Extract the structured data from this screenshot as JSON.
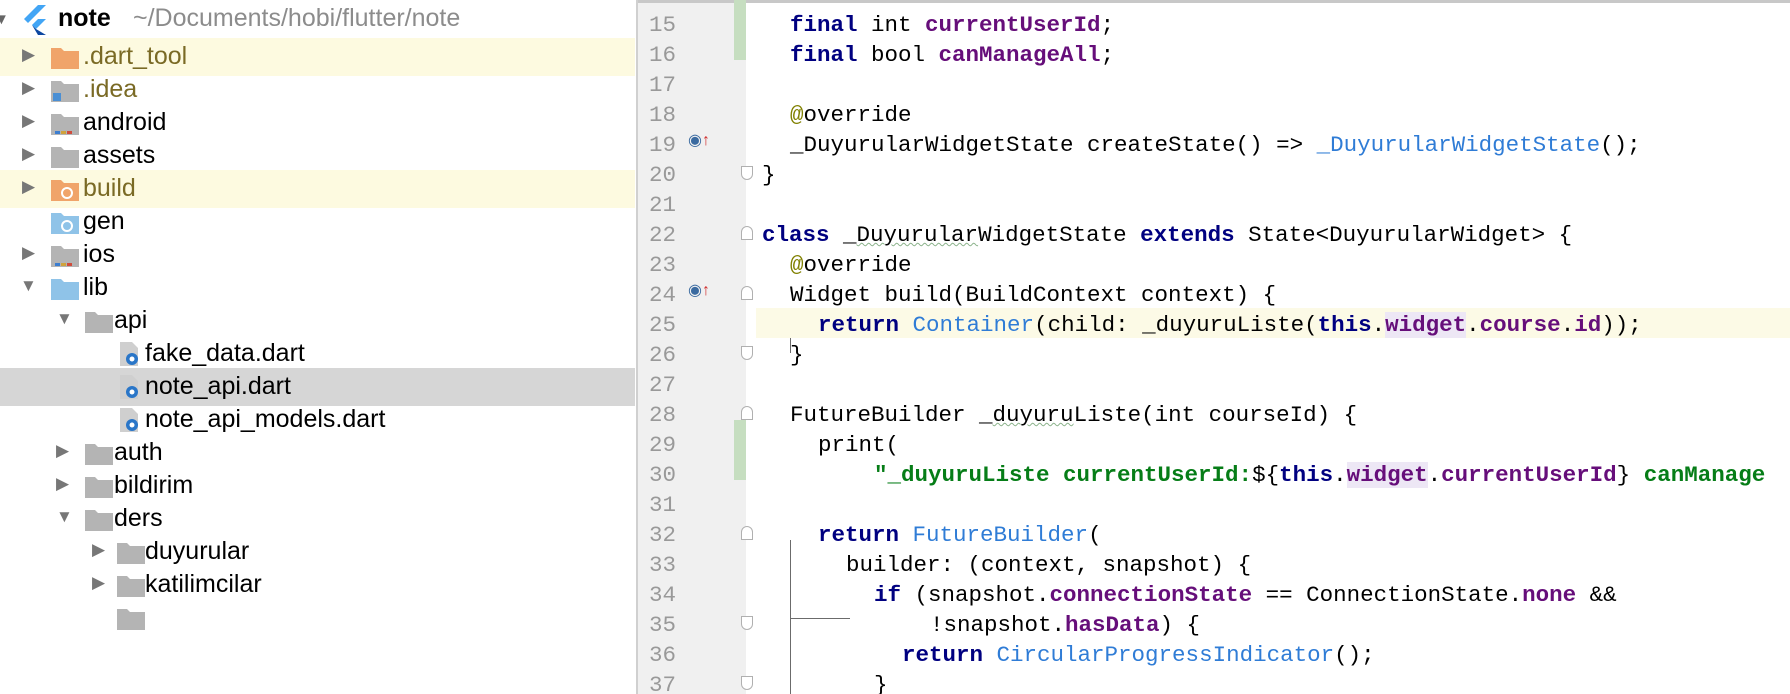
{
  "project": {
    "name": "note",
    "path": "~/Documents/hobi/flutter/note"
  },
  "tree": [
    {
      "label": ".dart_tool",
      "icon": "folder-orange-icon",
      "expanded": false,
      "excluded": true,
      "highlight": true
    },
    {
      "label": ".idea",
      "icon": "folder-idea-icon",
      "expanded": false,
      "excluded": true
    },
    {
      "label": "android",
      "icon": "folder-module-icon",
      "expanded": false
    },
    {
      "label": "assets",
      "icon": "folder-icon",
      "expanded": false
    },
    {
      "label": "build",
      "icon": "folder-build-icon",
      "expanded": false,
      "excluded": true,
      "highlight": true
    },
    {
      "label": "gen",
      "icon": "folder-generated-icon"
    },
    {
      "label": "ios",
      "icon": "folder-module-icon",
      "expanded": false
    },
    {
      "label": "lib",
      "icon": "folder-source-icon",
      "expanded": true
    },
    {
      "label": "api",
      "icon": "folder-icon",
      "expanded": true
    },
    {
      "label": "fake_data.dart",
      "icon": "dart-file-icon"
    },
    {
      "label": "note_api.dart",
      "icon": "dart-file-icon",
      "selected": true
    },
    {
      "label": "note_api_models.dart",
      "icon": "dart-file-icon"
    },
    {
      "label": "auth",
      "icon": "folder-icon",
      "expanded": false
    },
    {
      "label": "bildirim",
      "icon": "folder-icon",
      "expanded": false
    },
    {
      "label": "ders",
      "icon": "folder-icon",
      "expanded": true
    },
    {
      "label": "duyurular",
      "icon": "folder-icon",
      "expanded": false
    },
    {
      "label": "katilimcilar",
      "icon": "folder-icon",
      "expanded": false
    }
  ],
  "editor": {
    "line_numbers": [
      "15",
      "16",
      "17",
      "18",
      "19",
      "20",
      "21",
      "22",
      "23",
      "24",
      "25",
      "26",
      "27",
      "28",
      "29",
      "30",
      "31",
      "32",
      "33",
      "34",
      "35",
      "36",
      "37"
    ],
    "current_line": "25",
    "tokens": {
      "l15": [
        "final",
        " int ",
        "currentUserId",
        ";"
      ],
      "l16": [
        "final",
        " bool ",
        "canManageAll",
        ";"
      ],
      "l18": [
        "@",
        "override"
      ],
      "l19": [
        "_DuyurularWidgetState createState() => ",
        "_DuyurularWidgetState",
        "();"
      ],
      "l20": [
        "}"
      ],
      "l22": [
        "class",
        " _",
        "Duyurular",
        "WidgetState ",
        "extends",
        " State<DuyurularWidget> {"
      ],
      "l23": [
        "@",
        "override"
      ],
      "l24": [
        "Widget build(BuildContext context) {"
      ],
      "l25": [
        "return",
        " ",
        "Container",
        "(child: _duyuruListe(",
        "this",
        ".",
        "widget",
        ".",
        "course",
        ".",
        "id",
        "));"
      ],
      "l26": [
        "}"
      ],
      "l28": [
        "FutureBuilder _",
        "duyuru",
        "Liste(int courseId) {"
      ],
      "l29": [
        "print("
      ],
      "l30": [
        "\"_duyuruListe currentUserId:",
        "${",
        "this",
        ".",
        "widget",
        ".",
        "currentUserId",
        "}",
        " canManage"
      ],
      "l32": [
        "return",
        " ",
        "FutureBuilder",
        "("
      ],
      "l33": [
        "builder: (context, snapshot) {"
      ],
      "l34": [
        "if",
        " (snapshot.",
        "connectionState",
        " == ConnectionState.",
        "none",
        " &&"
      ],
      "l35": [
        "!snapshot.",
        "hasData",
        ") {"
      ],
      "l36": [
        "return",
        " ",
        "CircularProgressIndicator",
        "();"
      ],
      "l37": [
        "}"
      ]
    }
  },
  "colors": {
    "keyword": "#000080",
    "field": "#660e7a",
    "string": "#067d17",
    "class_ref": "#2f7cd6",
    "annotation": "#808000",
    "current_line_bg": "#fcfae6",
    "excluded_folder_bg": "#fdfae0",
    "selected_row_bg": "#d6d6d6",
    "vcs_changed": "#c6dec0"
  }
}
